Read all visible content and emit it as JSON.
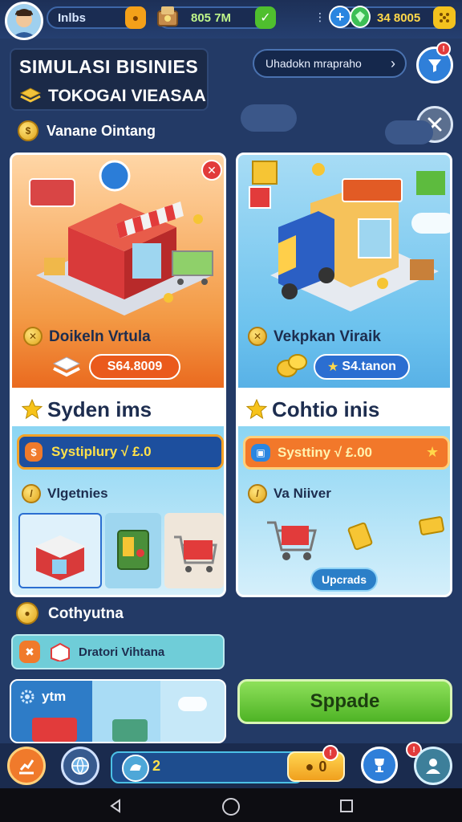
{
  "top": {
    "player_name": "Inlbs",
    "money": "805 7M",
    "gems": "34 8005"
  },
  "header": {
    "title": "SIMULASI BISINIES",
    "subtitle": "TOKOGAI VIEASAA",
    "search_label": "Uhadokn mrapraho",
    "section_label": "Vanane Ointang"
  },
  "left_card": {
    "name": "Doikeln Vrtula",
    "price": "S64.8009",
    "heading": "Syden ims",
    "bar_label": "Systiplury √ £.0",
    "sub_label": "Vlgetnies"
  },
  "right_card": {
    "name": "Vekpkan Viraik",
    "price": "S4.tanon",
    "heading": "Cohtio inis",
    "bar_label": "Systtiny √ £.00",
    "sub_label": "Va Niiver",
    "upgrade_label": "Upcrads"
  },
  "bottom": {
    "section_label": "Cothyutna",
    "list_label": "Dratori Vihtana",
    "mini_label": "ytm",
    "action_label": "Sppade",
    "counter_value": "2",
    "coin_value": "0"
  },
  "colors": {
    "accent_green": "#5cc92a",
    "accent_orange": "#f07a2b",
    "accent_blue": "#2b6ed1",
    "background": "#233a66"
  },
  "icons": [
    "avatar-icon",
    "coin-icon",
    "cash-icon",
    "check-icon",
    "plus-icon",
    "gem-icon",
    "dice-icon",
    "chevron-right-icon",
    "notification-icon",
    "crossed-tools-icon",
    "close-icon",
    "star-icon",
    "home-icon",
    "trophy-icon",
    "profile-icon"
  ]
}
